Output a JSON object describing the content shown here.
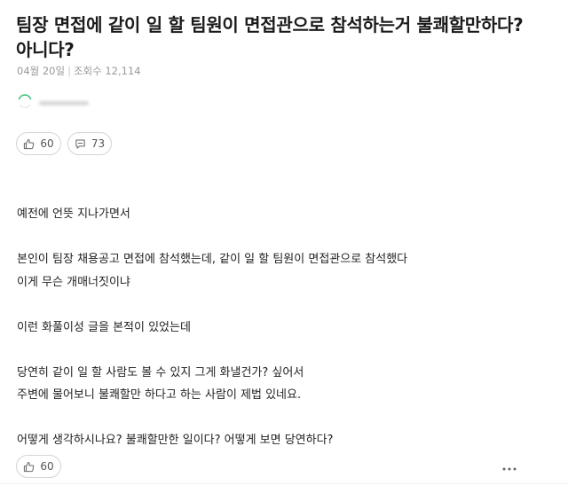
{
  "post": {
    "title": "팀장 면접에 같이 일 할 팀원이 면접관으로 참석하는거 불쾌할만하다? 아니다?",
    "date": "04월 20일",
    "meta_separator": "|",
    "views": "조회수 12,114"
  },
  "reactions_top": {
    "like_count": "60",
    "comment_count": "73"
  },
  "body": {
    "paragraphs": [
      [
        "예전에 언뜻 지나가면서"
      ],
      [
        "본인이 팀장 채용공고 면접에 참석했는데, 같이 일 할 팀원이 면접관으로 참석했다",
        "이게 무슨 개매너짓이냐"
      ],
      [
        "이런 화풀이성 글을 본적이 있었는데"
      ],
      [
        "당연히 같이 일 할 사람도 볼 수 있지 그게 화낼건가? 싶어서",
        "주변에 물어보니 불쾌할만 하다고 하는 사람이 제법 있네요."
      ],
      [
        "어떻게 생각하시나요? 불쾌할만한 일이다? 어떻게 보면 당연하다?"
      ]
    ]
  },
  "reactions_bottom": {
    "like_count": "60"
  },
  "icons": {
    "like": "thumbs-up-icon",
    "comment": "comment-icon",
    "more": "more-dots-icon",
    "avatar": "avatar-ring"
  },
  "colors": {
    "text": "#222222",
    "meta": "#9a9a9a",
    "border": "#d4d4d4",
    "avatar_green": "#3cc47c"
  }
}
